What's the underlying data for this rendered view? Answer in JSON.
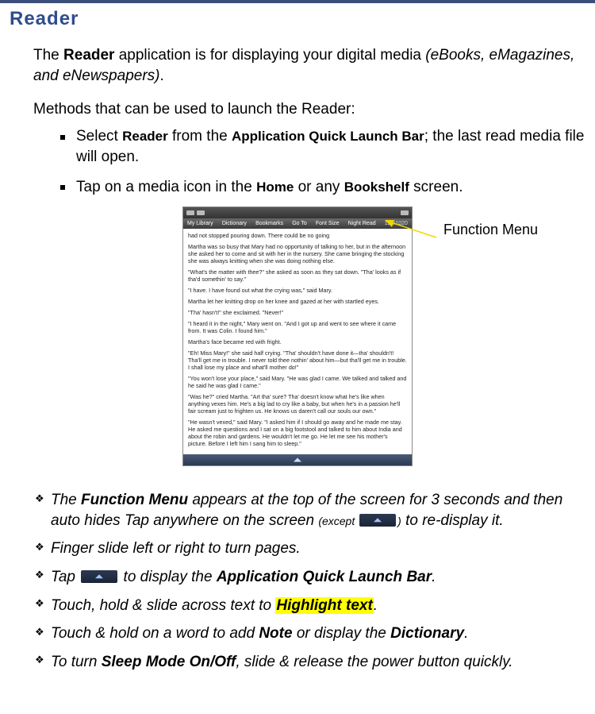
{
  "heading": "Reader",
  "intro_pre": "The ",
  "intro_bold": "Reader",
  "intro_mid": " application is for displaying your digital media ",
  "intro_italic": "(eBooks, eMagazines, and eNewspapers)",
  "intro_suffix": ".",
  "methods_pre": "Methods that can be used to launch the ",
  "methods_bold": "Reader",
  "methods_suffix": ":",
  "bullets": [
    {
      "pre": "Select ",
      "b1": "Reader",
      "mid1": " from the ",
      "b2": "Application Quick Launch Bar",
      "tail": "; the last read media file will open."
    },
    {
      "pre": "Tap on a media icon in the ",
      "b1": "Home",
      "mid1": " or any ",
      "b2": "Bookshelf",
      "tail": " screen."
    }
  ],
  "screenshot": {
    "menu_items": [
      "My Library",
      "Dictionary",
      "Bookmarks",
      "Go To",
      "Font Size",
      "Night Read"
    ],
    "page_indicator": "128/1020",
    "paragraphs": [
      "had not stopped pouring down. There could be no going",
      "Martha was so busy that Mary had no opportunity of talking to her, but in the afternoon she asked her to come and sit with her in the nursery. She came bringing the stocking she was always knitting when she was doing nothing else.",
      "\"What's the matter with thee?\" she asked as soon as they sat down. \"Tha' looks as if tha'd somethin' to say.\"",
      "\"I have. I have found out what the crying was,\" said Mary.",
      "Martha let her knitting drop on her knee and gazed at her with startled eyes.",
      "\"Tha' hasn't!\" she exclaimed. \"Never!\"",
      "\"I heard it in the night,\" Mary went on. \"And I got up and went to see where it came from. It was Colin. I found him.\"",
      "Martha's face became red with fright.",
      "\"Eh! Miss Mary!\" she said half crying. \"Tha' shouldn't have done it—tha' shouldn't! Tha'll get me in trouble. I never told thee nothin' about him—but tha'll get me in trouble. I shall lose my place and what'll mother do!\"",
      "\"You won't lose your place,\" said Mary. \"He was glad I came. We talked and talked and he said he was glad I came.\"",
      "\"Was he?\" cried Martha. \"Art tha' sure? Tha' doesn't know what he's like when anything vexes him. He's a big lad to cry like a baby, but when he's in a passion he'll fair scream just to frighten us. He knows us daren't call our souls our own.\"",
      "\"He wasn't vexed,\" said Mary. \"I asked him if I should go away and he made me stay. He asked me questions and I sat on a big footstool and talked to him about India and about the robin and gardens. He wouldn't let me go. He let me see his mother's picture. Before I left him I sang him to sleep.\""
    ]
  },
  "callout_label": "Function Menu",
  "tips": {
    "t1_pre": "The ",
    "t1_b": "Function Menu",
    "t1_mid": " appears at the top of the screen for 3 seconds and then auto hides Tap anywhere on the screen ",
    "t1_except_open": "(except ",
    "t1_except_close": ")",
    "t1_tail": " to re-display it.",
    "t2": "Finger slide left or right to turn pages.",
    "t3_pre": "Tap ",
    "t3_mid": " to display the ",
    "t3_b": "Application Quick Launch Bar",
    "t3_tail": ".",
    "t4_pre": "Touch, hold & slide across text to ",
    "t4_hl": "Highlight text",
    "t4_tail": ".",
    "t5_pre": "Touch & hold on a word to add ",
    "t5_b1": "Note",
    "t5_mid": " or display the ",
    "t5_b2": "Dictionary",
    "t5_tail": ".",
    "t6_pre": "To turn ",
    "t6_b": "Sleep Mode On/Off",
    "t6_tail": ", slide & release the power button quickly."
  }
}
